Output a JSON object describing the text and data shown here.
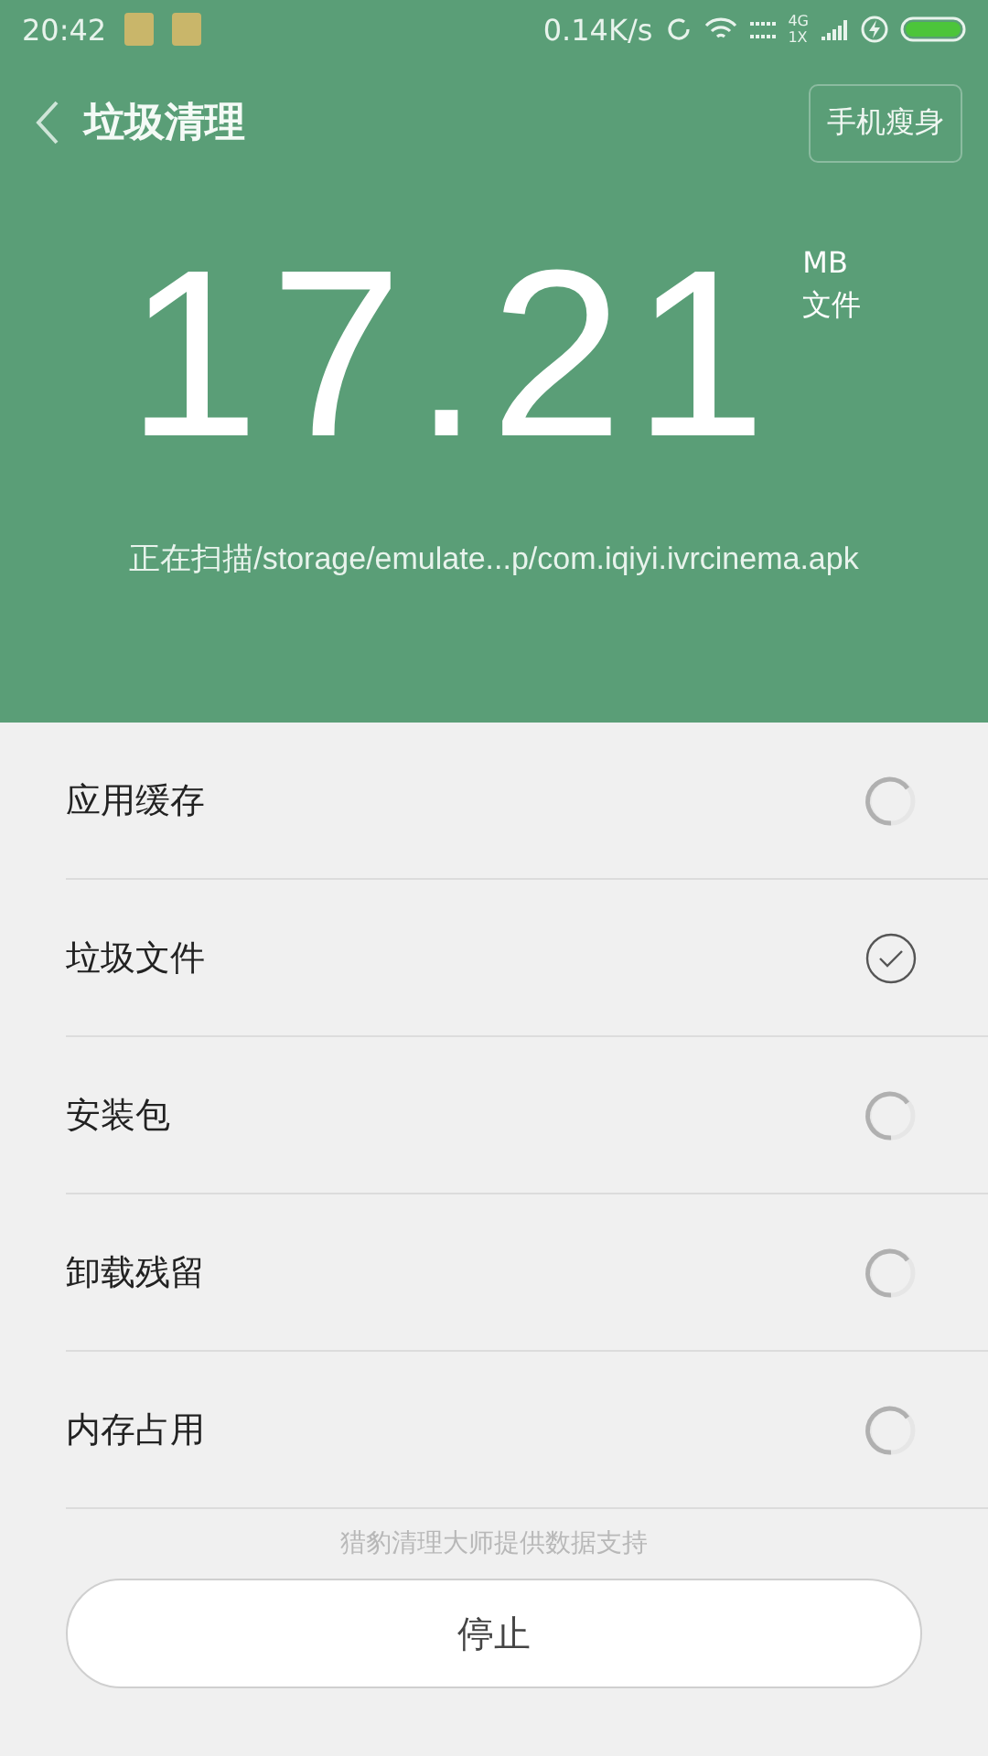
{
  "status_bar": {
    "time": "20:42",
    "speed": "0.14K/s",
    "network": "4G",
    "network_sub": "1X"
  },
  "header": {
    "title": "垃圾清理",
    "action": "手机瘦身"
  },
  "summary": {
    "amount": "17.21",
    "unit": "MB",
    "unit_label": "文件",
    "scanning": "正在扫描/storage/emulate...p/com.iqiyi.ivrcinema.apk"
  },
  "items": [
    {
      "label": "应用缓存",
      "done": false
    },
    {
      "label": "垃圾文件",
      "done": true
    },
    {
      "label": "安装包",
      "done": false
    },
    {
      "label": "卸载残留",
      "done": false
    },
    {
      "label": "内存占用",
      "done": false
    }
  ],
  "footer": {
    "credit": "猎豹清理大师提供数据支持",
    "button": "停止"
  }
}
